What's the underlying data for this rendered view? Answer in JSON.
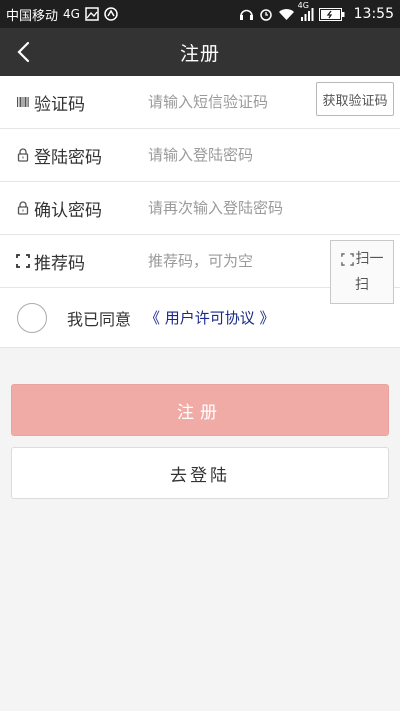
{
  "status_bar": {
    "carrier": "中国移动",
    "network": "4G",
    "signal_network": "4G",
    "time": "13:55",
    "icons": [
      "gallery-icon",
      "headset-icon",
      "alarm-icon",
      "wifi-icon",
      "signal-icon",
      "battery-icon"
    ]
  },
  "nav": {
    "title": "注册",
    "back_icon": "chevron-left-icon"
  },
  "form": {
    "verify_code": {
      "label": "验证码",
      "placeholder": "请输入短信验证码",
      "button": "获取验证码",
      "icon": "sms-code-icon"
    },
    "password": {
      "label": "登陆密码",
      "placeholder": "请输入登陆密码",
      "icon": "lock-icon"
    },
    "confirm_password": {
      "label": "确认密码",
      "placeholder": "请再次输入登陆密码",
      "icon": "lock-icon"
    },
    "referral": {
      "label": "推荐码",
      "placeholder": "推荐码，可为空",
      "scan_line1": "扫一",
      "scan_line2": "扫",
      "icon": "scan-frame-icon"
    }
  },
  "agreement": {
    "text": "我已同意",
    "link": "《 用户许可协议 》",
    "checked": false
  },
  "buttons": {
    "register": "注册",
    "go_login": "去登陆"
  },
  "colors": {
    "status_bar_bg": "#1f1f1f",
    "nav_bg": "#333333",
    "register_bg": "#f1aba6",
    "link": "#1a2a8a"
  }
}
